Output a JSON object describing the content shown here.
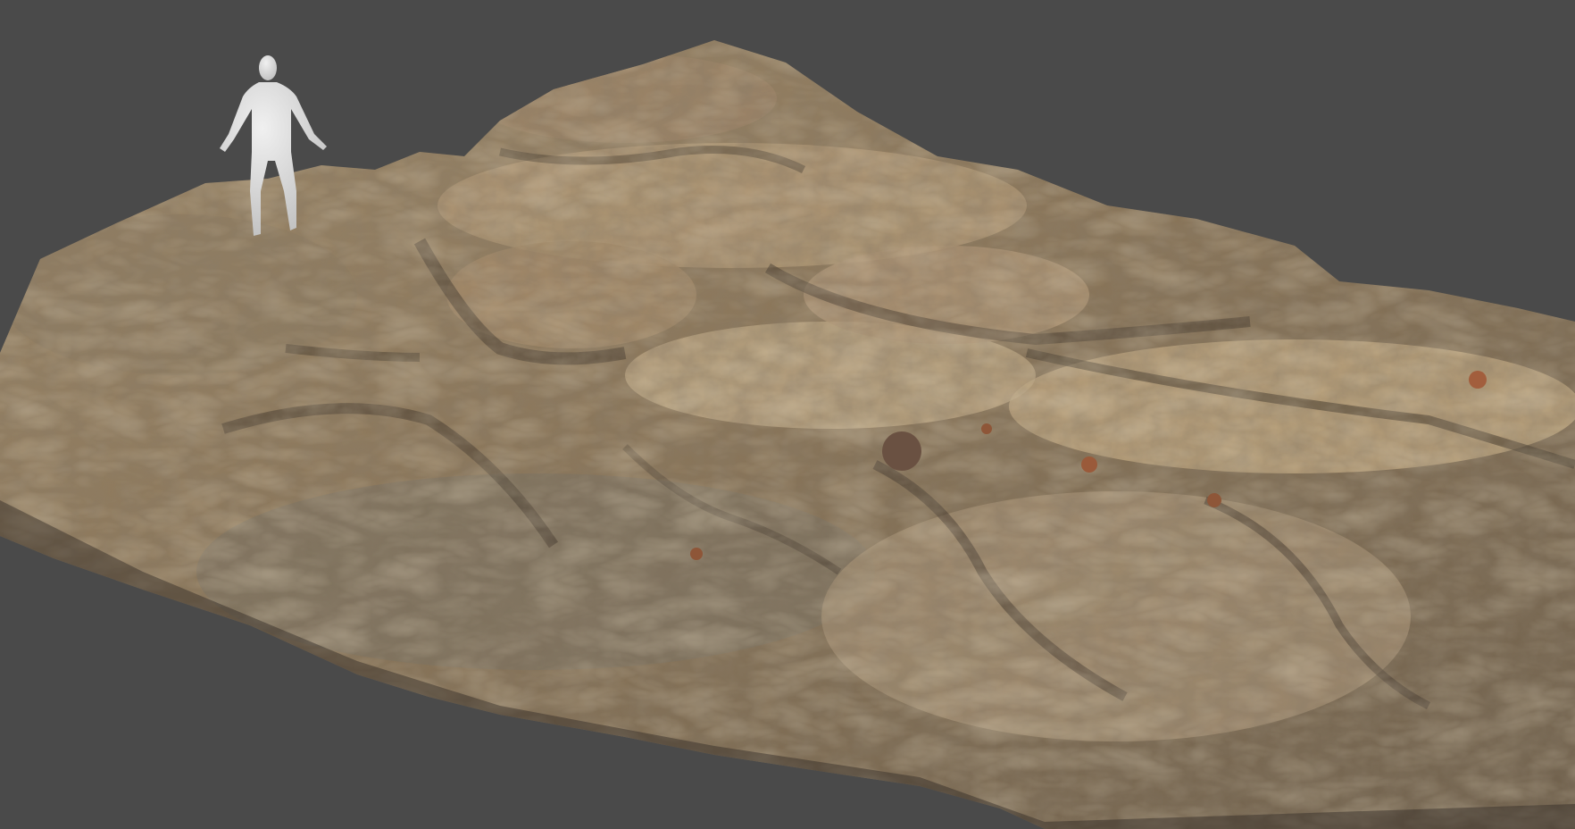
{
  "viewport": {
    "background_color": "#4a4a4a"
  },
  "scene": {
    "rock_palette": {
      "light": "#c8b08a",
      "mid": "#9b8363",
      "dark": "#5a4a38",
      "shadow": "#3a3228",
      "cool": "#7d7a72",
      "rust": "#9a5a3a"
    },
    "figure_color": "#dcdcdc"
  }
}
